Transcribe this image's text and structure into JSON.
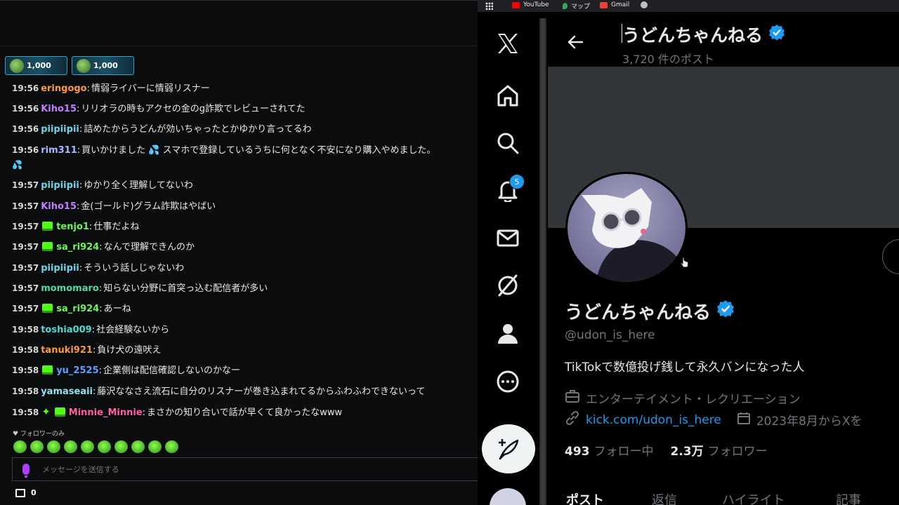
{
  "chat": {
    "gifts": [
      {
        "amount": "1,000"
      },
      {
        "amount": "1,000"
      }
    ],
    "messages": [
      {
        "time": "19:56",
        "user": "eringogo",
        "color": "#ff9a3c",
        "text": "情弱ライバーに情弱リスナー",
        "badge": false,
        "star": false
      },
      {
        "time": "19:56",
        "user": "Kiho15",
        "color": "#c77dff",
        "text": "リリオラの時もアクセの金のg詐欺でレビューされてた",
        "badge": false,
        "star": false
      },
      {
        "time": "19:56",
        "user": "piipiipii",
        "color": "#6cd6e8",
        "text": "詰めたからうどんが効いちゃったとかゆかり言ってるわ",
        "badge": false,
        "star": false
      },
      {
        "time": "19:56",
        "user": "rim311",
        "color": "#a9b8ff",
        "text": "買いかけました 💦 スマホで登録しているうちに何となく不安になり購入やめました。",
        "badge": false,
        "star": false
      },
      {
        "time": "19:57",
        "user": "piipiipii",
        "color": "#6cd6e8",
        "text": "ゆかり全く理解してないわ",
        "badge": false,
        "star": false
      },
      {
        "time": "19:57",
        "user": "Kiho15",
        "color": "#c77dff",
        "text": "金(ゴールド)グラム詐欺はやばい",
        "badge": false,
        "star": false
      },
      {
        "time": "19:57",
        "user": "tenjo1",
        "color": "#6ef55b",
        "text": "仕事だよね",
        "badge": true,
        "star": false
      },
      {
        "time": "19:57",
        "user": "sa_ri924",
        "color": "#6ef55b",
        "text": "なんで理解できんのか",
        "badge": true,
        "star": false
      },
      {
        "time": "19:57",
        "user": "piipiipii",
        "color": "#6cd6e8",
        "text": "そういう話しじゃないわ",
        "badge": false,
        "star": false
      },
      {
        "time": "19:57",
        "user": "momomaro",
        "color": "#4fd9a3",
        "text": "知らない分野に首突っ込む配信者が多い",
        "badge": false,
        "star": false
      },
      {
        "time": "19:57",
        "user": "sa_ri924",
        "color": "#6ef55b",
        "text": "あーね",
        "badge": true,
        "star": false
      },
      {
        "time": "19:58",
        "user": "toshia009",
        "color": "#4fd9d0",
        "text": "社会経験ないから",
        "badge": false,
        "star": false
      },
      {
        "time": "19:58",
        "user": "tanuki921",
        "color": "#ff9a3c",
        "text": "負け犬の遠吠え",
        "badge": false,
        "star": false
      },
      {
        "time": "19:58",
        "user": "yu_2525",
        "color": "#5aa0ff",
        "text": "企業側は配信確認しないのかなー",
        "badge": true,
        "star": false
      },
      {
        "time": "19:58",
        "user": "yamaseaii",
        "color": "#8fe3f0",
        "text": "藤沢ななさえ流石に自分のリスナーが巻き込まれてるからふわふわできないって",
        "badge": false,
        "star": false
      },
      {
        "time": "19:58",
        "user": "Minnie_Minnie",
        "color": "#ff5fa2",
        "text": "まさかの知り合いで話が早くて良かったなwww",
        "badge": true,
        "star": true
      }
    ],
    "wrap_text": "💦",
    "followers_only": "♥ フォロワーのみ",
    "input_placeholder": "メッセージを送信する",
    "footer_count": "0"
  },
  "browser": {
    "bookmarks": [
      {
        "label": "YouTube",
        "color": "#ff0000"
      },
      {
        "label": "マップ",
        "color": "#34a853"
      },
      {
        "label": "Gmail",
        "color": "#ea4335"
      }
    ]
  },
  "x": {
    "notification_count": "5",
    "header_name": "うどんちゃんねる",
    "post_count": "3,720 件のポスト",
    "display_name": "うどんちゃんねる",
    "handle": "@udon_is_here",
    "bio": "TikTokで数億投げ銭して永久バンになった人",
    "category": "エンターテイメント・レクリエーション",
    "link": "kick.com/udon_is_here",
    "joined": "2023年8月からXを",
    "following_count": "493",
    "following_label": "フォロー中",
    "followers_count": "2.3万",
    "followers_label": "フォロワー",
    "tabs": [
      "ポスト",
      "返信",
      "ハイライト",
      "記事"
    ],
    "accent_color": "#1d9bf0"
  }
}
